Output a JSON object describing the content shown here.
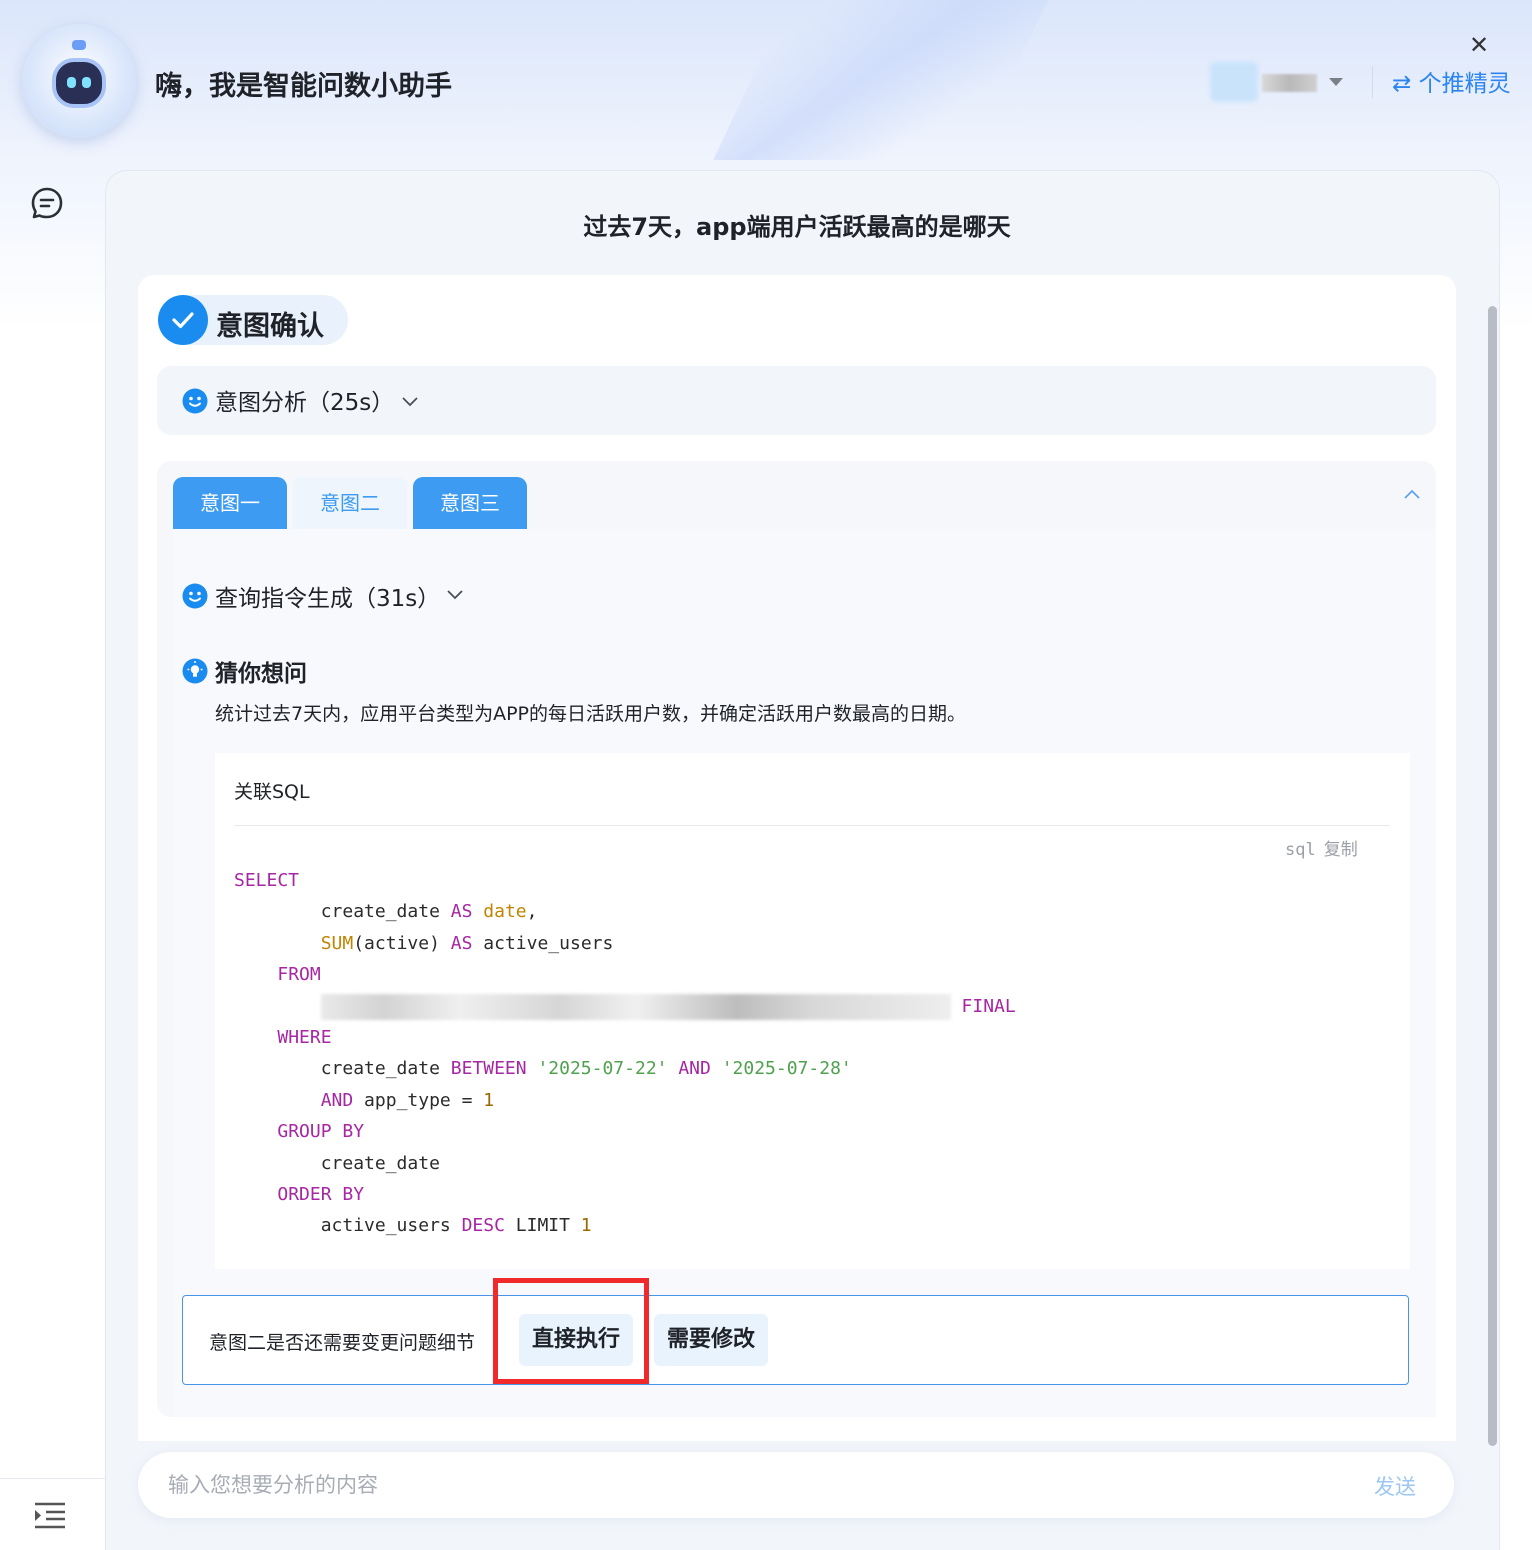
{
  "header": {
    "title": "嗨，我是智能问数小助手",
    "switch_label": "⇄ 个推精灵"
  },
  "question": "过去7天，app端用户活跃最高的是哪天",
  "step": {
    "chip_label": "意图确认",
    "analysis_label": "意图分析（25s）"
  },
  "intent_tabs": [
    {
      "label": "意图一",
      "active": true
    },
    {
      "label": "意图二",
      "active": false
    },
    {
      "label": "意图三",
      "active": true
    }
  ],
  "intent": {
    "generate_label": "查询指令生成（31s）",
    "guess_label": "猜你想问",
    "guess_text": "统计过去7天内，应用平台类型为APP的每日活跃用户数，并确定活跃用户数最高的日期。",
    "sql": {
      "title": "关联SQL",
      "lang": "sql",
      "copy_label": "复制",
      "lines": [
        "SELECT",
        "        create_date AS date,",
        "        SUM(active) AS active_users",
        "    FROM",
        "        [redacted] FINAL",
        "    WHERE",
        "        create_date BETWEEN '2025-07-22' AND '2025-07-28'",
        "        AND app_type = 1",
        "    GROUP BY",
        "        create_date",
        "    ORDER BY",
        "        active_users DESC LIMIT 1"
      ]
    },
    "confirm": {
      "question": "意图二是否还需要变更问题细节",
      "execute_label": "直接执行",
      "modify_label": "需要修改"
    }
  },
  "input": {
    "placeholder": "输入您想要分析的内容",
    "send_label": "发送"
  },
  "colors": {
    "accent": "#1a8cf0",
    "tab_active": "#3d9bf2",
    "highlight_frame": "#f02a2a"
  }
}
